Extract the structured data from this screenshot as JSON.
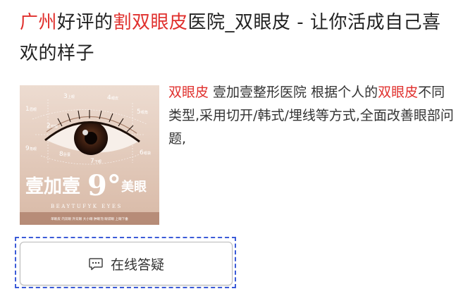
{
  "title": {
    "seg1": "广州",
    "seg2": "好评的",
    "seg3": "割双眼皮",
    "seg4": "医院_双眼皮 - 让你活成自己喜欢的样子",
    "highlight_color": "#e0302d"
  },
  "description": {
    "seg1": "双眼皮",
    "seg2": " 壹加壹整形医院 根据个人的",
    "seg3": "双眼皮",
    "seg4": "不同类型,采用切开/韩式/埋线等方式,全面改善眼部问题,"
  },
  "thumbnail": {
    "brand": "壹加壹",
    "brand_number": "9°",
    "brand_suffix": "美眼",
    "subtitle": "BEAYTUFYK EYES",
    "points": [
      {
        "num": "1",
        "label": "眉眼"
      },
      {
        "num": "3",
        "label": "上眼"
      },
      {
        "num": "4",
        "label": "眼皮"
      },
      {
        "num": "2",
        "label": "双眼"
      },
      {
        "num": "5",
        "label": "眼角"
      },
      {
        "num": "9",
        "label": "角眼"
      },
      {
        "num": "8",
        "label": "卧蚕"
      },
      {
        "num": "7",
        "label": "下眼"
      },
      {
        "num": "6",
        "label": "眼袋"
      }
    ],
    "footer": "单眼皮 内双眼 外双眼 大小眼 肿眼泡 眼袋眼 上眼下垂"
  },
  "consult_button": {
    "label": "在线答疑",
    "icon": "chat-bubble-icon",
    "border_color": "#3b5bd8"
  }
}
